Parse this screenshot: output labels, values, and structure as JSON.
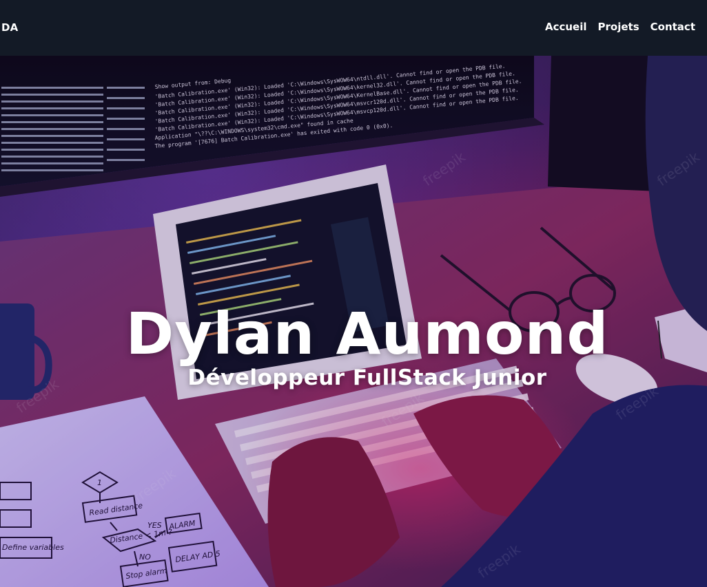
{
  "navbar": {
    "brand": "DA",
    "links": [
      {
        "label": "Accueil"
      },
      {
        "label": "Projets"
      },
      {
        "label": "Contact"
      }
    ]
  },
  "hero": {
    "title": "Dylan Aumond",
    "subtitle": "Développeur FullStack Junior",
    "background_image": {
      "code_lines": [
        "Show output from:  Debug",
        "'Batch Calibration.exe' (Win32): Loaded 'C:\\Windows\\SysWOW64\\ntdll.dll'. Cannot find or open the PDB file.",
        "'Batch Calibration.exe' (Win32): Loaded 'C:\\Windows\\SysWOW64\\kernel32.dll'. Cannot find or open the PDB file.",
        "'Batch Calibration.exe' (Win32): Loaded 'C:\\Windows\\SysWOW64\\KernelBase.dll'. Cannot find or open the PDB file.",
        "'Batch Calibration.exe' (Win32): Loaded 'C:\\Windows\\SysWOW64\\msvcr120d.dll'. Cannot find or open the PDB file.",
        "'Batch Calibration.exe' (Win32): Loaded 'C:\\Windows\\SysWOW64\\msvcp120d.dll'. Cannot find or open the PDB file.",
        "Application \"\\??\\C:\\WINDOWS\\system32\\cmd.exe\" found in cache",
        "The program '[7676] Batch Calibration.exe' has exited with code 0 (0x0)."
      ],
      "flowchart_labels": [
        "1",
        "Read distance",
        "Distance < 1m ?",
        "YES",
        "ALARM",
        "NO",
        "DELAY AD 5",
        "Stop alarm",
        "Define variables"
      ],
      "watermark": "freepik"
    },
    "colors": {
      "navbar_bg": "#131a26",
      "text": "#ffffff",
      "accent_magenta": "#ff2a6d",
      "accent_violet": "#7b4dff"
    }
  }
}
